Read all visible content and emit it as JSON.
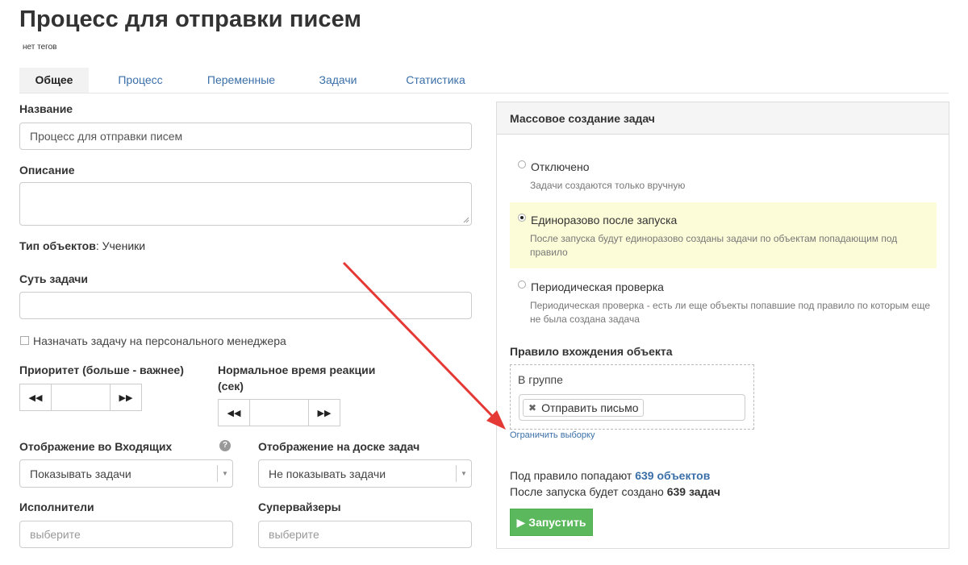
{
  "page": {
    "title": "Процесс для отправки писем",
    "tags": "нет тегов"
  },
  "tabs": [
    {
      "label": "Общее"
    },
    {
      "label": "Процесс"
    },
    {
      "label": "Переменные"
    },
    {
      "label": "Задачи"
    },
    {
      "label": "Статистика"
    }
  ],
  "form": {
    "name_label": "Название",
    "name_value": "Процесс для отправки писем",
    "description_label": "Описание",
    "object_type_label": "Тип объектов",
    "object_type_value": ": Ученики",
    "task_essence_label": "Суть задачи",
    "assign_manager_label": "Назначать задачу на персонального менеджера",
    "priority_label": "Приоритет (больше - важнее)",
    "reaction_label_line1": "Нормальное время реакции",
    "reaction_label_line2": "(сек)",
    "inbox_display_label": "Отображение во Входящих",
    "inbox_display_value": "Показывать задачи",
    "board_display_label": "Отображение на доске задач",
    "board_display_value": "Не показывать задачи",
    "executors_label": "Исполнители",
    "executors_placeholder": "выберите",
    "supervisors_label": "Супервайзеры",
    "supervisors_placeholder": "выберите"
  },
  "mass": {
    "header": "Массовое создание задач",
    "options": [
      {
        "title": "Отключено",
        "desc1": "Задачи создаются только вручную",
        "desc2": "",
        "checked": false
      },
      {
        "title": "Единоразово после запуска",
        "desc1": "После запуска будут единоразово созданы задачи по объектам попадающим под",
        "desc2": "правило",
        "checked": true
      },
      {
        "title": "Периодическая проверка",
        "desc1": "Периодическая проверка - есть ли еще объекты попавшие под правило по которым еще",
        "desc2": "не была создана задача",
        "checked": false
      }
    ],
    "rule_label": "Правило вхождения объекта",
    "group_label": "В группе",
    "chip_text": "Отправить письмо",
    "limit_link": "Ограничить выборку",
    "summary1_prefix": "Под правило попадают ",
    "summary1_link": "639 объектов",
    "summary2_prefix": "После запуска будет создано ",
    "summary2_bold": "639 задач",
    "run_button": "Запустить"
  },
  "colors": {
    "accent": "#3a6fa8",
    "run": "#5cb85c",
    "highlight": "#fcfcd8",
    "arrow": "#e53935"
  }
}
